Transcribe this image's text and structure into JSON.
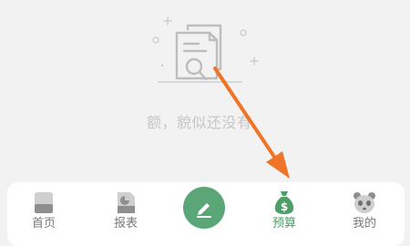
{
  "empty_state": {
    "message": "额，貌似还没有",
    "illustration_icon": "document-search-icon"
  },
  "annotation": {
    "color": "#f07427",
    "icon": "arrow-icon"
  },
  "bottom_nav": {
    "active_item": "预算",
    "items": [
      {
        "label": "首页",
        "icon": "home-icon"
      },
      {
        "label": "报表",
        "icon": "report-icon"
      },
      {
        "label": "预算",
        "icon": "money-bag-icon"
      },
      {
        "label": "我的",
        "icon": "panda-icon"
      }
    ],
    "fab_icon": "pencil-icon",
    "accent_color": "#5aa677"
  }
}
